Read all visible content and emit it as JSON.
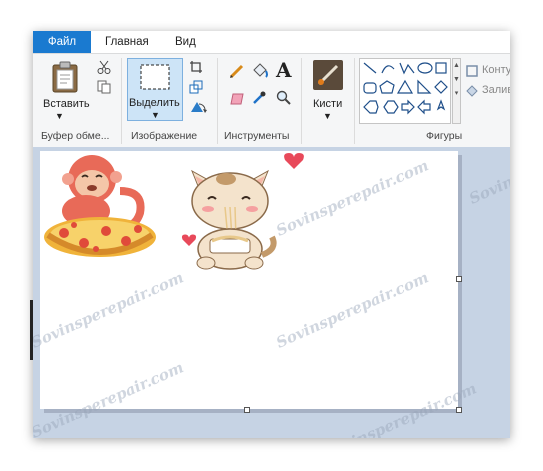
{
  "tabs": [
    {
      "label": "Файл"
    },
    {
      "label": "Главная"
    },
    {
      "label": "Вид"
    }
  ],
  "clipboard": {
    "paste_label": "Вставить",
    "group_label": "Буфер обме..."
  },
  "image": {
    "select_label": "Выделить",
    "group_label": "Изображение"
  },
  "tools": {
    "text_glyph": "A",
    "group_label": "Инструменты"
  },
  "brushes": {
    "label": "Кисти"
  },
  "shapes": {
    "outline_label": "Конту",
    "fill_label": "Залив",
    "group_label": "Фигуры"
  },
  "watermark": "Sovinsperepair.com",
  "colors": {
    "file_tab": "#1a7ad0",
    "canvas_bg": "#c6d3e4",
    "select_active": "#cde4f7"
  }
}
